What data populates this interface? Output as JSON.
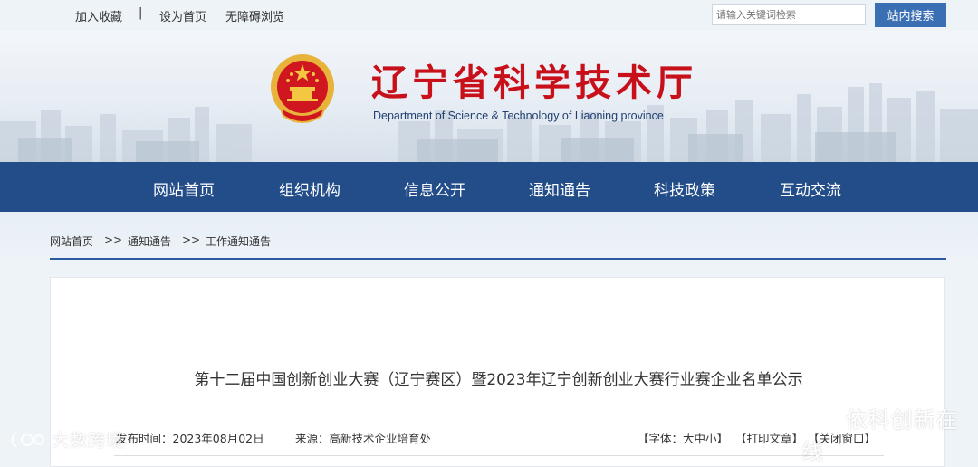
{
  "topbar": {
    "add_favorite": "加入收藏",
    "separator": "|",
    "set_homepage": "设为首页",
    "accessibility": "无障碍浏览",
    "search_placeholder": "请输入关键词检索",
    "search_button": "站内搜索"
  },
  "header": {
    "title": "辽宁省科学技术厅",
    "subtitle": "Department of Science & Technology of Liaoning province",
    "emblem_icon": "national-emblem-icon",
    "title_color": "#c8101a"
  },
  "nav": {
    "background": "#234d88",
    "items": [
      "网站首页",
      "组织机构",
      "信息公开",
      "通知通告",
      "科技政策",
      "互动交流"
    ]
  },
  "breadcrumb": {
    "items": [
      "网站首页",
      "通知通告",
      "工作通知通告"
    ],
    "separator": ">>"
  },
  "article": {
    "title": "第十二届中国创新创业大赛（辽宁赛区）暨2023年辽宁创新创业大赛行业赛企业名单公示",
    "publish_time": "发布时间：2023年08月02日",
    "source": "来源：高新技术企业培育处",
    "font_size_label": "【字体：大中小】",
    "print_label": "【打印文章】",
    "close_label": "【关闭窗口】"
  },
  "watermarks": {
    "left": "大数跨境",
    "right": "依科创新在线"
  }
}
